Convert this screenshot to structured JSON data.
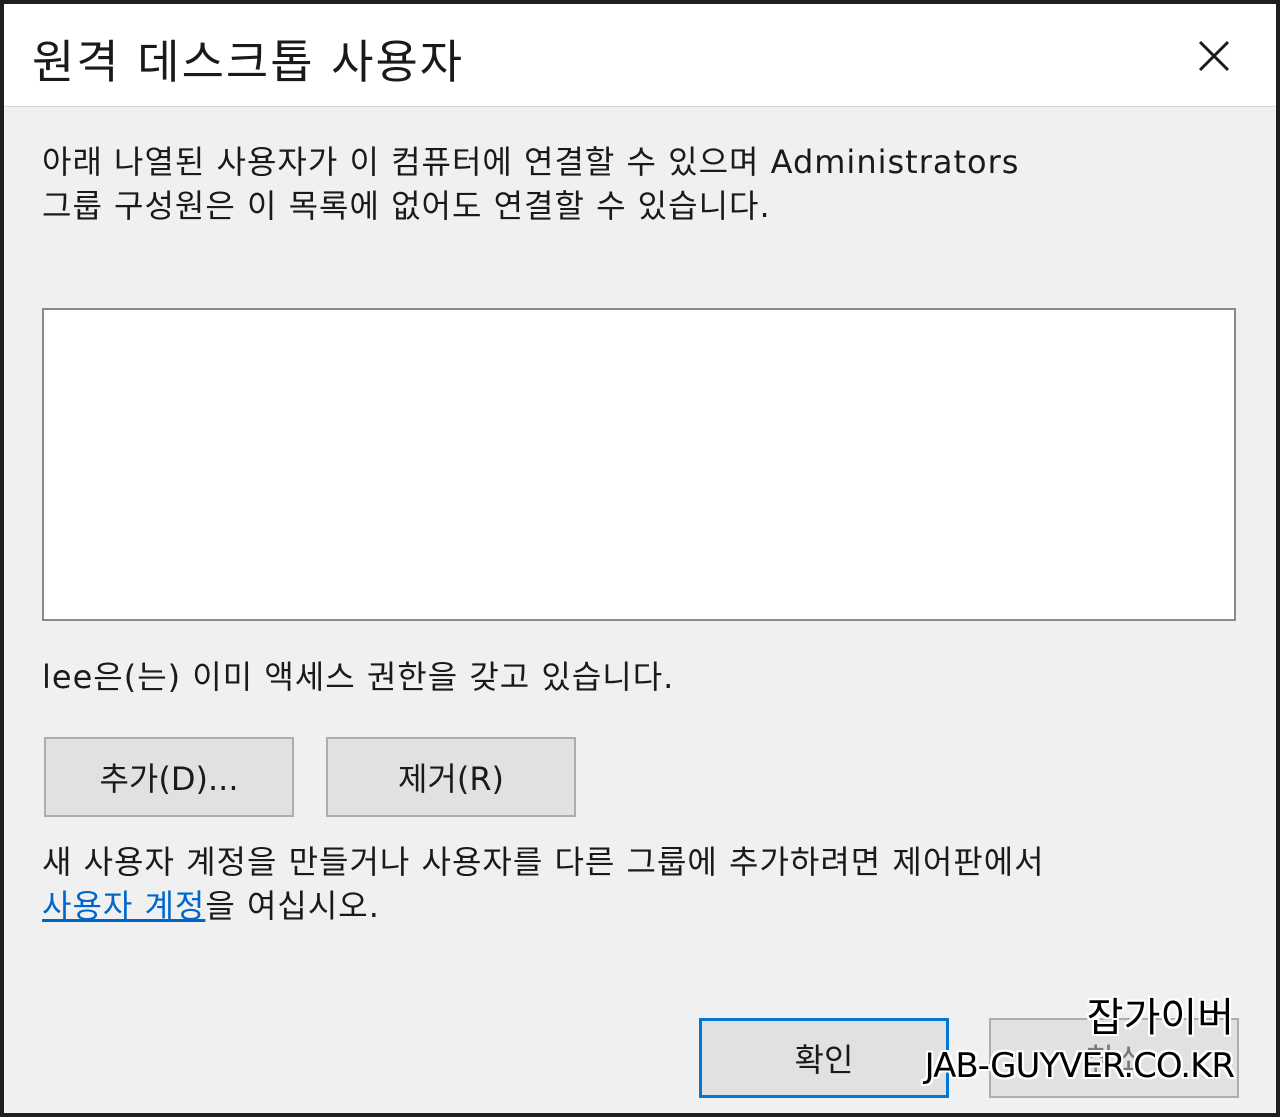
{
  "window": {
    "title": "원격 데스크톱 사용자",
    "close_icon": "close-icon"
  },
  "description": {
    "line1": "아래 나열된 사용자가 이 컴퓨터에 연결할 수 있으며 Administrators",
    "line2": "그룹 구성원은 이 목록에 없어도 연결할 수 있습니다."
  },
  "user_list": {
    "items": []
  },
  "access_note": "lee은(는) 이미 액세스 권한을 갖고 있습니다.",
  "buttons": {
    "add_label": "추가(D)...",
    "remove_label": "제거(R)",
    "ok_label": "확인",
    "cancel_label": "취소"
  },
  "footer_note": {
    "line1": "새 사용자 계정을 만들거나 사용자를 다른 그룹에 추가하려면 제어판에서",
    "link_text": "사용자 계정",
    "line2_suffix": "을 여십시오."
  },
  "watermark": {
    "korean": "잡가이버",
    "english": "JAB-GUYVER.CO.KR"
  },
  "colors": {
    "link": "#0066cc",
    "focus_border": "#0078d7",
    "dialog_bg": "#f0f0f0"
  }
}
